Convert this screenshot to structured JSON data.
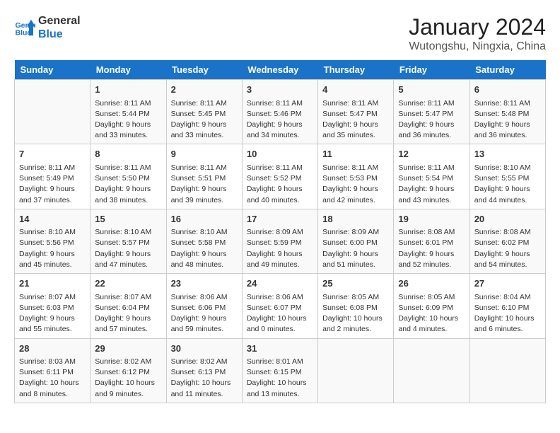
{
  "header": {
    "logo_line1": "General",
    "logo_line2": "Blue",
    "month_year": "January 2024",
    "location": "Wutongshu, Ningxia, China"
  },
  "weekdays": [
    "Sunday",
    "Monday",
    "Tuesday",
    "Wednesday",
    "Thursday",
    "Friday",
    "Saturday"
  ],
  "weeks": [
    [
      {
        "day": "",
        "info": ""
      },
      {
        "day": "1",
        "info": "Sunrise: 8:11 AM\nSunset: 5:44 PM\nDaylight: 9 hours\nand 33 minutes."
      },
      {
        "day": "2",
        "info": "Sunrise: 8:11 AM\nSunset: 5:45 PM\nDaylight: 9 hours\nand 33 minutes."
      },
      {
        "day": "3",
        "info": "Sunrise: 8:11 AM\nSunset: 5:46 PM\nDaylight: 9 hours\nand 34 minutes."
      },
      {
        "day": "4",
        "info": "Sunrise: 8:11 AM\nSunset: 5:47 PM\nDaylight: 9 hours\nand 35 minutes."
      },
      {
        "day": "5",
        "info": "Sunrise: 8:11 AM\nSunset: 5:47 PM\nDaylight: 9 hours\nand 36 minutes."
      },
      {
        "day": "6",
        "info": "Sunrise: 8:11 AM\nSunset: 5:48 PM\nDaylight: 9 hours\nand 36 minutes."
      }
    ],
    [
      {
        "day": "7",
        "info": "Sunrise: 8:11 AM\nSunset: 5:49 PM\nDaylight: 9 hours\nand 37 minutes."
      },
      {
        "day": "8",
        "info": "Sunrise: 8:11 AM\nSunset: 5:50 PM\nDaylight: 9 hours\nand 38 minutes."
      },
      {
        "day": "9",
        "info": "Sunrise: 8:11 AM\nSunset: 5:51 PM\nDaylight: 9 hours\nand 39 minutes."
      },
      {
        "day": "10",
        "info": "Sunrise: 8:11 AM\nSunset: 5:52 PM\nDaylight: 9 hours\nand 40 minutes."
      },
      {
        "day": "11",
        "info": "Sunrise: 8:11 AM\nSunset: 5:53 PM\nDaylight: 9 hours\nand 42 minutes."
      },
      {
        "day": "12",
        "info": "Sunrise: 8:11 AM\nSunset: 5:54 PM\nDaylight: 9 hours\nand 43 minutes."
      },
      {
        "day": "13",
        "info": "Sunrise: 8:10 AM\nSunset: 5:55 PM\nDaylight: 9 hours\nand 44 minutes."
      }
    ],
    [
      {
        "day": "14",
        "info": "Sunrise: 8:10 AM\nSunset: 5:56 PM\nDaylight: 9 hours\nand 45 minutes."
      },
      {
        "day": "15",
        "info": "Sunrise: 8:10 AM\nSunset: 5:57 PM\nDaylight: 9 hours\nand 47 minutes."
      },
      {
        "day": "16",
        "info": "Sunrise: 8:10 AM\nSunset: 5:58 PM\nDaylight: 9 hours\nand 48 minutes."
      },
      {
        "day": "17",
        "info": "Sunrise: 8:09 AM\nSunset: 5:59 PM\nDaylight: 9 hours\nand 49 minutes."
      },
      {
        "day": "18",
        "info": "Sunrise: 8:09 AM\nSunset: 6:00 PM\nDaylight: 9 hours\nand 51 minutes."
      },
      {
        "day": "19",
        "info": "Sunrise: 8:08 AM\nSunset: 6:01 PM\nDaylight: 9 hours\nand 52 minutes."
      },
      {
        "day": "20",
        "info": "Sunrise: 8:08 AM\nSunset: 6:02 PM\nDaylight: 9 hours\nand 54 minutes."
      }
    ],
    [
      {
        "day": "21",
        "info": "Sunrise: 8:07 AM\nSunset: 6:03 PM\nDaylight: 9 hours\nand 55 minutes."
      },
      {
        "day": "22",
        "info": "Sunrise: 8:07 AM\nSunset: 6:04 PM\nDaylight: 9 hours\nand 57 minutes."
      },
      {
        "day": "23",
        "info": "Sunrise: 8:06 AM\nSunset: 6:06 PM\nDaylight: 9 hours\nand 59 minutes."
      },
      {
        "day": "24",
        "info": "Sunrise: 8:06 AM\nSunset: 6:07 PM\nDaylight: 10 hours\nand 0 minutes."
      },
      {
        "day": "25",
        "info": "Sunrise: 8:05 AM\nSunset: 6:08 PM\nDaylight: 10 hours\nand 2 minutes."
      },
      {
        "day": "26",
        "info": "Sunrise: 8:05 AM\nSunset: 6:09 PM\nDaylight: 10 hours\nand 4 minutes."
      },
      {
        "day": "27",
        "info": "Sunrise: 8:04 AM\nSunset: 6:10 PM\nDaylight: 10 hours\nand 6 minutes."
      }
    ],
    [
      {
        "day": "28",
        "info": "Sunrise: 8:03 AM\nSunset: 6:11 PM\nDaylight: 10 hours\nand 8 minutes."
      },
      {
        "day": "29",
        "info": "Sunrise: 8:02 AM\nSunset: 6:12 PM\nDaylight: 10 hours\nand 9 minutes."
      },
      {
        "day": "30",
        "info": "Sunrise: 8:02 AM\nSunset: 6:13 PM\nDaylight: 10 hours\nand 11 minutes."
      },
      {
        "day": "31",
        "info": "Sunrise: 8:01 AM\nSunset: 6:15 PM\nDaylight: 10 hours\nand 13 minutes."
      },
      {
        "day": "",
        "info": ""
      },
      {
        "day": "",
        "info": ""
      },
      {
        "day": "",
        "info": ""
      }
    ]
  ]
}
